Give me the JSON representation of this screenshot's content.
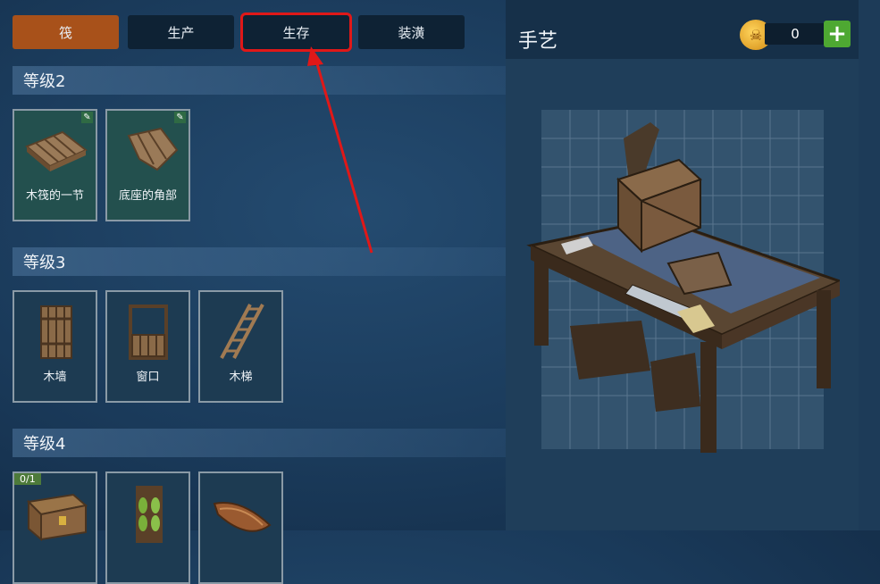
{
  "tabs": [
    {
      "label": "筏"
    },
    {
      "label": "生产"
    },
    {
      "label": "生存"
    },
    {
      "label": "装潢"
    }
  ],
  "levels": [
    {
      "title": "等级2",
      "items": [
        {
          "label": "木筏的一节"
        },
        {
          "label": "底座的角部"
        }
      ]
    },
    {
      "title": "等级3",
      "items": [
        {
          "label": "木墙"
        },
        {
          "label": "窗口"
        },
        {
          "label": "木梯"
        }
      ]
    },
    {
      "title": "等级4",
      "items": [
        {
          "count": "0/1"
        },
        {},
        {}
      ]
    }
  ],
  "detail": {
    "title": "手艺",
    "currency": "0"
  },
  "colors": {
    "active_tab": "#a8511a",
    "highlight": "#e01818",
    "plus_button": "#4ea832"
  }
}
